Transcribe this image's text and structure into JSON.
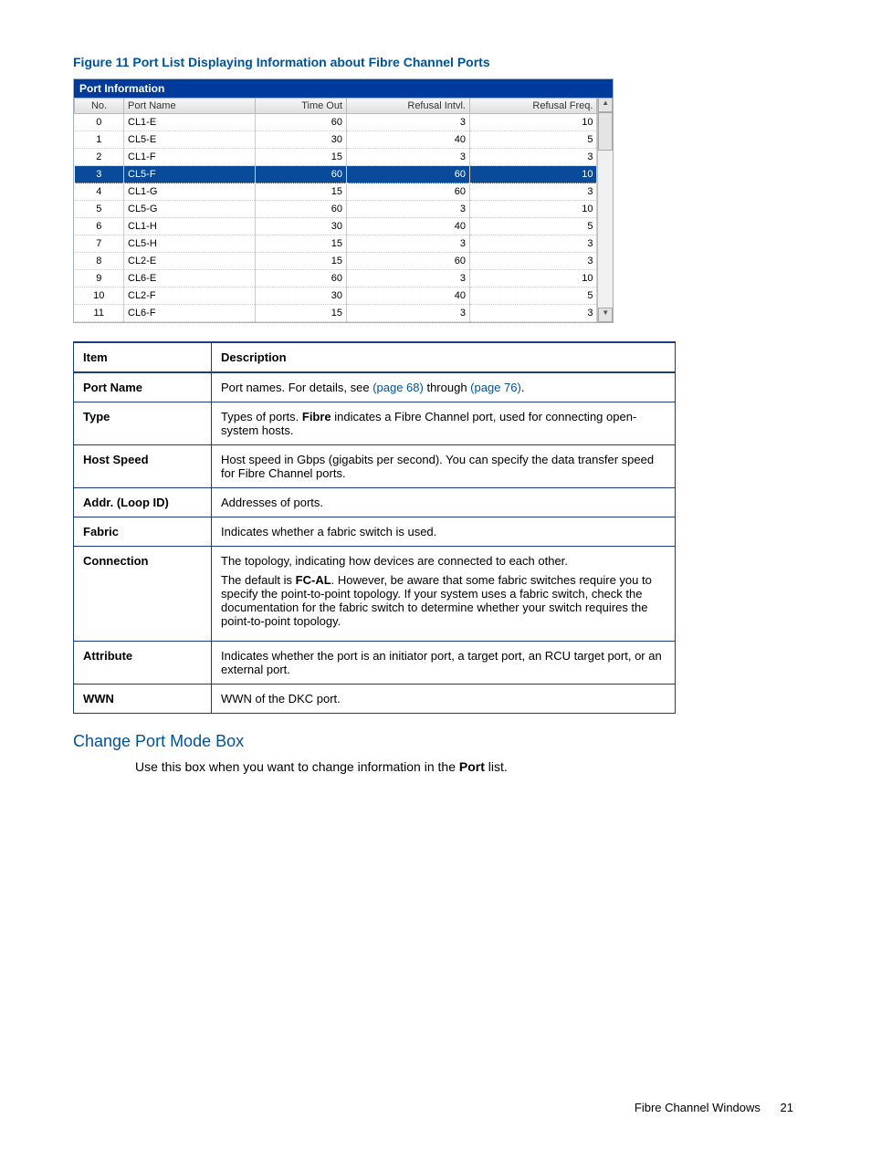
{
  "figure_caption": "Figure 11 Port List Displaying Information about Fibre Channel Ports",
  "port_window": {
    "title": "Port Information",
    "headers": {
      "no": "No.",
      "name": "Port Name",
      "timeout": "Time Out",
      "intvl": "Refusal Intvl.",
      "freq": "Refusal Freq."
    },
    "rows": [
      {
        "no": "0",
        "name": "CL1-E",
        "timeout": "60",
        "intvl": "3",
        "freq": "10",
        "selected": false
      },
      {
        "no": "1",
        "name": "CL5-E",
        "timeout": "30",
        "intvl": "40",
        "freq": "5",
        "selected": false
      },
      {
        "no": "2",
        "name": "CL1-F",
        "timeout": "15",
        "intvl": "3",
        "freq": "3",
        "selected": false
      },
      {
        "no": "3",
        "name": "CL5-F",
        "timeout": "60",
        "intvl": "60",
        "freq": "10",
        "selected": true
      },
      {
        "no": "4",
        "name": "CL1-G",
        "timeout": "15",
        "intvl": "60",
        "freq": "3",
        "selected": false
      },
      {
        "no": "5",
        "name": "CL5-G",
        "timeout": "60",
        "intvl": "3",
        "freq": "10",
        "selected": false
      },
      {
        "no": "6",
        "name": "CL1-H",
        "timeout": "30",
        "intvl": "40",
        "freq": "5",
        "selected": false
      },
      {
        "no": "7",
        "name": "CL5-H",
        "timeout": "15",
        "intvl": "3",
        "freq": "3",
        "selected": false
      },
      {
        "no": "8",
        "name": "CL2-E",
        "timeout": "15",
        "intvl": "60",
        "freq": "3",
        "selected": false
      },
      {
        "no": "9",
        "name": "CL6-E",
        "timeout": "60",
        "intvl": "3",
        "freq": "10",
        "selected": false
      },
      {
        "no": "10",
        "name": "CL2-F",
        "timeout": "30",
        "intvl": "40",
        "freq": "5",
        "selected": false
      },
      {
        "no": "11",
        "name": "CL6-F",
        "timeout": "15",
        "intvl": "3",
        "freq": "3",
        "selected": false
      }
    ]
  },
  "desc_table": {
    "headers": {
      "item": "Item",
      "desc": "Description"
    },
    "rows": {
      "port_name": {
        "item": "Port Name",
        "t1": "Port names. For details, see ",
        "l1": "(page 68)",
        "t2": " through ",
        "l2": "(page 76)",
        "t3": "."
      },
      "type": {
        "item": "Type",
        "t1": "Types of ports. ",
        "b1": "Fibre",
        "t2": " indicates a Fibre Channel port, used for connecting open-system hosts."
      },
      "host_speed": {
        "item": "Host Speed",
        "t1": "Host speed in Gbps (gigabits per second). You can specify the data transfer speed for Fibre Channel ports."
      },
      "addr": {
        "item": "Addr. (Loop ID)",
        "t1": "Addresses of ports."
      },
      "fabric": {
        "item": "Fabric",
        "t1": "Indicates whether a fabric switch is used."
      },
      "connection": {
        "item": "Connection",
        "t1": "The topology, indicating how devices are connected to each other.",
        "t2a": "The default is ",
        "b": "FC-AL",
        "t2b": ". However, be aware that some fabric switches require you to specify the point-to-point topology. If your system uses a fabric switch, check the documentation for the fabric switch to determine whether your switch requires the point-to-point topology."
      },
      "attribute": {
        "item": "Attribute",
        "t1": "Indicates whether the port is an initiator port, a target port, an RCU target port, or an external port."
      },
      "wwn": {
        "item": "WWN",
        "t1": "WWN of the DKC port."
      }
    }
  },
  "section_heading": "Change Port Mode Box",
  "body": {
    "t1": "Use this box when you want to change information in the ",
    "b": "Port",
    "t2": " list."
  },
  "footer": {
    "section": "Fibre Channel Windows",
    "page": "21"
  }
}
